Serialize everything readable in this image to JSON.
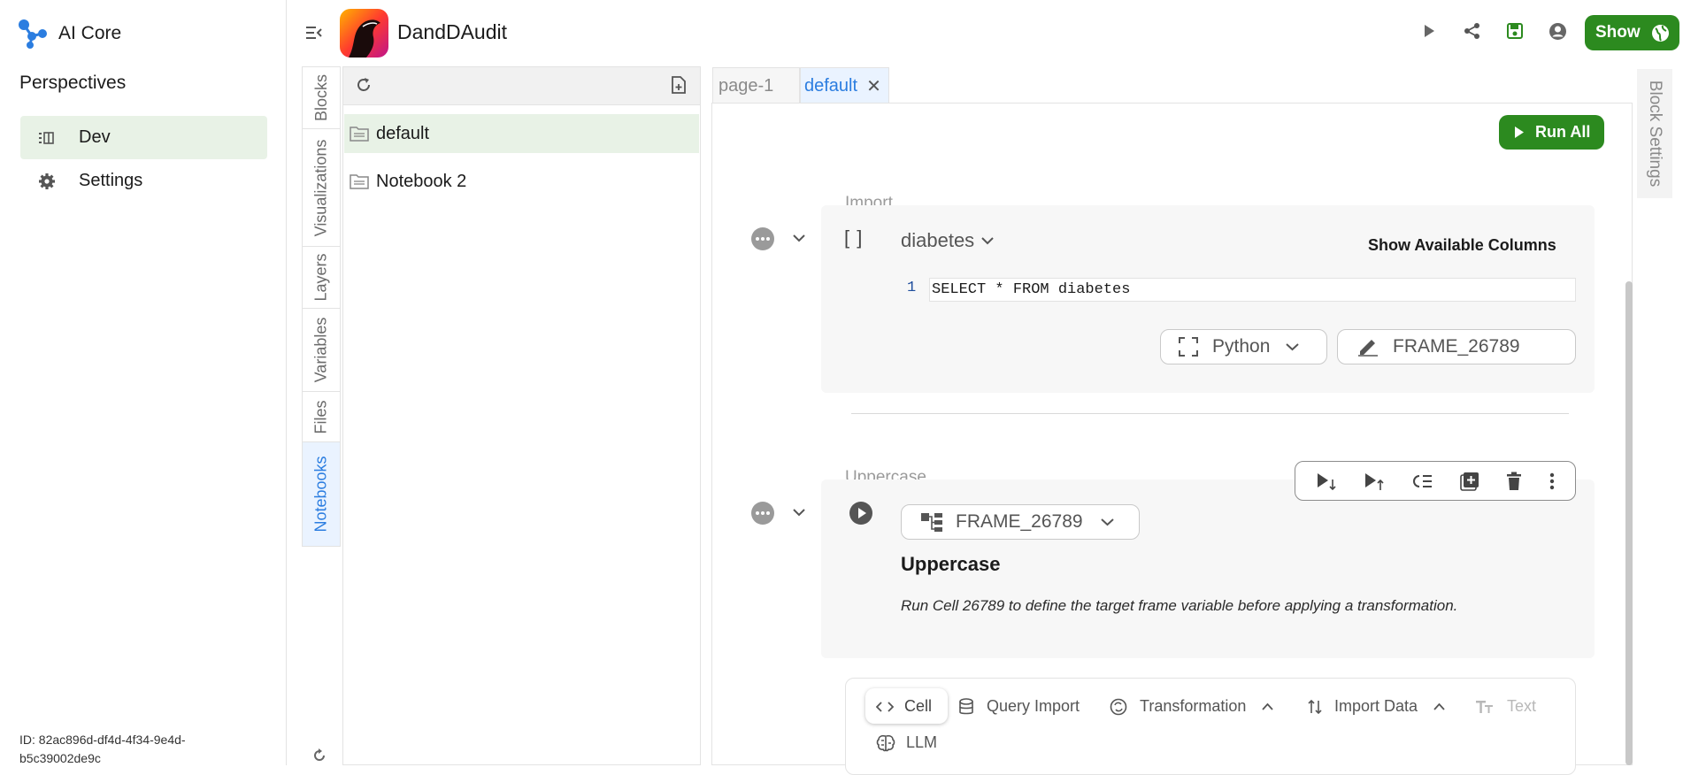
{
  "brand": {
    "name": "AI Core"
  },
  "perspectives": {
    "title": "Perspectives",
    "items": [
      {
        "label": "Dev",
        "icon": "dev-layout-icon",
        "active": true
      },
      {
        "label": "Settings",
        "icon": "gear-icon",
        "active": false
      }
    ]
  },
  "session": {
    "id": "ID: 82ac896d-df4d-4f34-9e4d-b5c39002de9c"
  },
  "app": {
    "title": "DandDAudit"
  },
  "topbar": {
    "show_label": "Show"
  },
  "side_tabs": [
    "Blocks",
    "Visualizations",
    "Layers",
    "Variables",
    "Files",
    "Notebooks"
  ],
  "side_tabs_active": "Notebooks",
  "notebooks": {
    "items": [
      {
        "label": "default",
        "active": true
      },
      {
        "label": "Notebook 2",
        "active": false
      }
    ]
  },
  "editor_tabs": [
    {
      "label": "page-1",
      "active": false
    },
    {
      "label": "default",
      "active": true,
      "closable": true
    }
  ],
  "editor": {
    "run_all_label": "Run All",
    "block_settings_label": "Block Settings",
    "import_cell": {
      "name": "Import",
      "brackets": "[ ]",
      "source": "diabetes",
      "show_columns_label": "Show Available Columns",
      "line_number": "1",
      "code": "SELECT * FROM diabetes",
      "language": "Python",
      "frame": "FRAME_26789"
    },
    "uppercase_cell": {
      "name": "Uppercase",
      "frame": "FRAME_26789",
      "heading": "Uppercase",
      "message": "Run Cell 26789 to define the target frame variable before applying a transformation."
    },
    "add_cell": {
      "items": [
        {
          "label": "Cell",
          "icon": "code-icon"
        },
        {
          "label": "Query Import",
          "icon": "database-icon"
        },
        {
          "label": "Transformation",
          "icon": "transform-icon"
        },
        {
          "label": "Import Data",
          "icon": "sort-arrows-icon"
        },
        {
          "label": "Text",
          "icon": "text-size-icon"
        },
        {
          "label": "LLM",
          "icon": "brain-icon"
        }
      ]
    }
  },
  "colors": {
    "accent_green": "#2c8a1f",
    "accent_blue": "#2b7de0",
    "active_bg": "#e8f2e6"
  }
}
